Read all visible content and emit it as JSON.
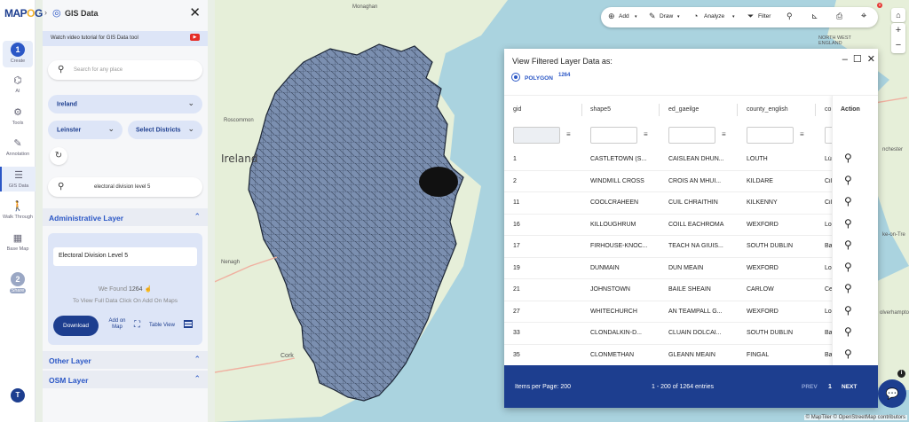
{
  "app": {
    "logo": "MAP",
    "logo_suffix": "O",
    "logo_tail": "G"
  },
  "rail": {
    "items": [
      {
        "step": "1",
        "label": "Create"
      },
      {
        "label": "AI"
      },
      {
        "label": "Tools"
      },
      {
        "label": "Annotation"
      },
      {
        "label": "GIS Data"
      },
      {
        "label": "Walk Through"
      },
      {
        "label": "Base Map"
      },
      {
        "step": "2",
        "label": "Share"
      }
    ],
    "user_initial": "T"
  },
  "panel": {
    "title": "GIS Data",
    "tutorial": "Watch video tutorial for GIS Data tool",
    "search_placeholder": "Search for any place",
    "country": "Ireland",
    "province": "Leinster",
    "districts": "Select Districts",
    "layer_search": "electoral division level 5",
    "admin_section": "Administrative Layer",
    "layer_name": "Electoral Division Level 5",
    "found_prefix": "We Found",
    "found_count": "1264",
    "hint": "To View Full Data Click On Add On Maps",
    "download": "Download",
    "add_on_map": "Add on Map",
    "table_view": "Table View",
    "other_section": "Other Layer",
    "osm_section": "OSM Layer"
  },
  "toolbar": {
    "add": "Add",
    "draw": "Draw",
    "analyze": "Analyze",
    "filter": "Filter"
  },
  "map_labels": {
    "country": "Ireland",
    "monaghan": "Monaghan",
    "roscommon": "Roscommon",
    "nenagh": "Nenagh",
    "cork": "Cork",
    "north_west_england": "NORTH WEST\nENGLAND",
    "manchester": "nchester",
    "stoke": "ke-on-Tre",
    "wolverhampton": "olverhampton"
  },
  "modal": {
    "title": "View Filtered Layer Data as:",
    "geometry": "POLYGON",
    "geometry_count": "1264",
    "columns": [
      "gid",
      "shape5",
      "ed_gaeilge",
      "county_english",
      "co"
    ],
    "action_header": "Action",
    "rows": [
      [
        "1",
        "CASTLETOWN (S...",
        "CAISLEÁN DHÚN...",
        "LOUTH",
        "Lú"
      ],
      [
        "2",
        "WINDMILL CROSS",
        "CROIS AN MHUI...",
        "KILDARE",
        "Cil"
      ],
      [
        "11",
        "COOLCRAHEEN",
        "CÚIL CHRAITHÍN",
        "KILKENNY",
        "Cil"
      ],
      [
        "16",
        "KILLOUGHRUM",
        "COILL EACHROMA",
        "WEXFORD",
        "Lo"
      ],
      [
        "17",
        "FIRHOUSE-KNOC...",
        "TEACH NA GIÚIS...",
        "SOUTH DUBLIN",
        "Ba"
      ],
      [
        "19",
        "DUNMAIN",
        "DÚN MEÁIN",
        "WEXFORD",
        "Lo"
      ],
      [
        "21",
        "JOHNSTOWN",
        "BAILE SHEÁIN",
        "CARLOW",
        "Ce"
      ],
      [
        "27",
        "WHITECHURCH",
        "AN TEAMPALL G...",
        "WEXFORD",
        "Lo"
      ],
      [
        "33",
        "CLONDALKIN-D...",
        "CLUAIN DOLCÁI...",
        "SOUTH DUBLIN",
        "Ba"
      ],
      [
        "35",
        "CLONMETHAN",
        "GLEANN MEÁIN",
        "FINGAL",
        "Ba"
      ]
    ],
    "items_per_page": "Items per Page: 200",
    "range": "1 - 200 of 1264 entries",
    "prev": "PREV",
    "page": "1",
    "next": "NEXT"
  },
  "attribution": "© MapTiler © OpenStreetMap contributors",
  "colors": {
    "primary": "#1d3e8f",
    "accent": "#2b57c6",
    "polygon_fill": "#7b8fb0",
    "sea": "#aad3df",
    "land": "#e6efd9"
  }
}
